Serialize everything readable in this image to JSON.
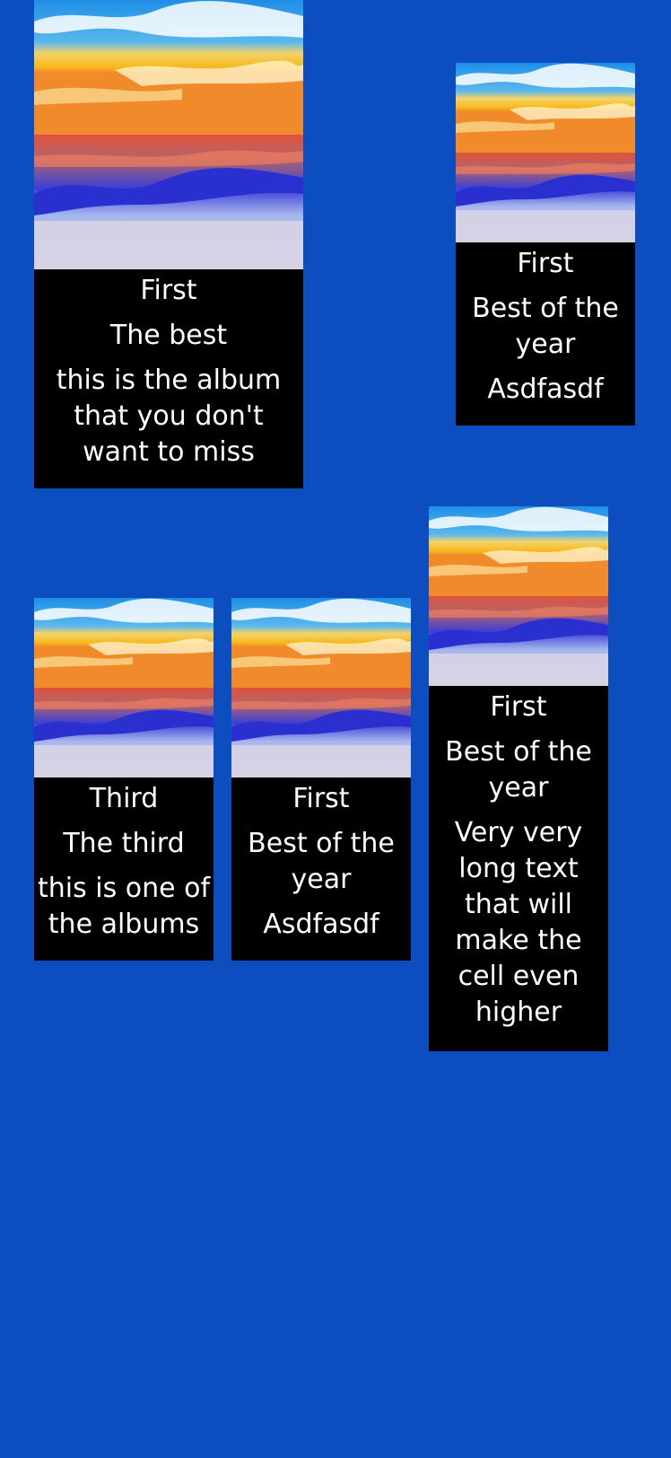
{
  "colors": {
    "background": "#0c4dbf",
    "cell_background": "#000000",
    "text": "#ffffff"
  },
  "cells": [
    {
      "artwork_icon": "beach-sunset-album-art",
      "title": "First",
      "subtitle": "The best",
      "description": "this is the album that you don't want to miss"
    },
    {
      "artwork_icon": "beach-sunset-album-art",
      "title": "First",
      "subtitle": "Best of the year",
      "description": "Asdfasdf"
    },
    {
      "artwork_icon": "beach-sunset-album-art",
      "title": "Third",
      "subtitle": "The third",
      "description": "this is one of the albums"
    },
    {
      "artwork_icon": "beach-sunset-album-art",
      "title": "First",
      "subtitle": "Best of the year",
      "description": "Asdfasdf"
    },
    {
      "artwork_icon": "beach-sunset-album-art",
      "title": "First",
      "subtitle": "Best of the year",
      "description": "Very very long text that will make the cell even higher"
    }
  ]
}
